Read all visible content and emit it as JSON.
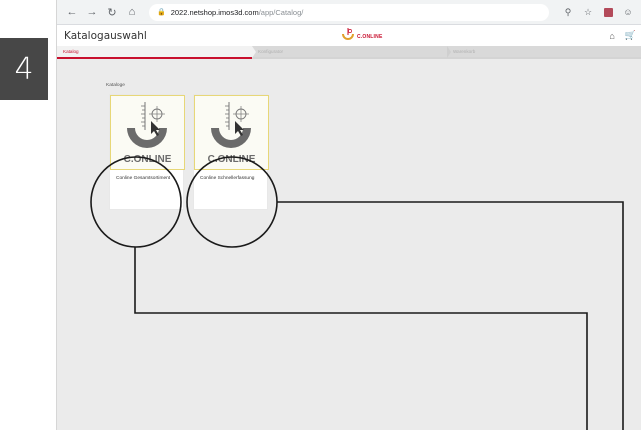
{
  "step_badge": "4",
  "browser": {
    "url_host": "2022.netshop.imos3d.com",
    "url_path": "/app/Catalog/",
    "icons": [
      "back-icon",
      "forward-icon",
      "reload-icon",
      "home-icon",
      "lock-icon",
      "zoom-icon",
      "star-icon",
      "extension-icon",
      "profile-icon"
    ]
  },
  "app": {
    "title": "Katalogauswahl",
    "brand": "C.ONLINE",
    "brand_color": "#c8102e"
  },
  "steps": [
    {
      "label": "Katalog",
      "active": true
    },
    {
      "label": "Konfigurator",
      "active": false
    },
    {
      "label": "Warenkorb",
      "active": false
    }
  ],
  "catalogs": {
    "label": "Kataloge",
    "items": [
      {
        "name": "Conline Gesamtsortiment",
        "logo_text": "C.ONLINE"
      },
      {
        "name": "Conline Schnellerfassung",
        "logo_text": "C.ONLINE"
      }
    ]
  },
  "colors": {
    "accent": "#c8102e",
    "card_border": "#e7d777",
    "logo_gray": "#6b6b6b"
  }
}
